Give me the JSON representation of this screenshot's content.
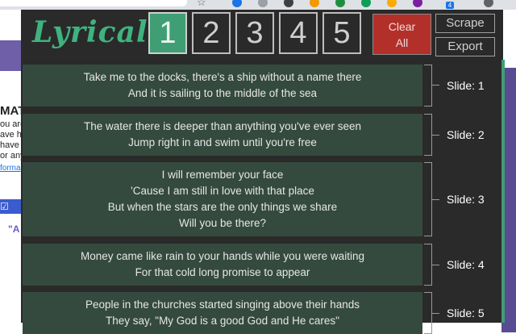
{
  "browser": {
    "star_icon": "star-icon",
    "extension_icons": [
      {
        "name": "blue-circle-extension-icon",
        "color": "#1a73e8"
      },
      {
        "name": "grey-circle-extension-icon",
        "color": "#9aa0a6"
      },
      {
        "name": "dark-extension-icon",
        "color": "#3c4043"
      },
      {
        "name": "orange-extension-icon",
        "color": "#f29900"
      },
      {
        "name": "green-extension-icon",
        "color": "#1e8e3e"
      },
      {
        "name": "teal-extension-icon",
        "color": "#0f9d58"
      },
      {
        "name": "yellow-extension-icon",
        "color": "#f9ab00"
      },
      {
        "name": "purple-extension-icon",
        "color": "#7b1fa2"
      },
      {
        "name": "profile-extension-icon",
        "color": "#5f6368"
      }
    ],
    "badge": "4"
  },
  "background_page": {
    "heading": "MAT",
    "lines": [
      "ou are",
      "ave ha",
      "have",
      "or any"
    ],
    "link": "forma",
    "email_button": "☑ Em",
    "quote": "\"A"
  },
  "extension": {
    "logo": "Lyrical",
    "number_buttons": [
      "1",
      "2",
      "3",
      "4",
      "5"
    ],
    "active_button": "1",
    "clear_button": {
      "line1": "Clear",
      "line2": "All"
    },
    "scrape_button": "Scrape",
    "export_button": "Export",
    "colors": {
      "accent": "#3f9e73",
      "clear": "#b3302a",
      "slide_bg": "#344a3f",
      "panel": "#2a2a2a"
    },
    "slides": [
      {
        "label": "Slide: 1",
        "lines": [
          "Take me to the docks, there's a ship without a name there",
          "And it is sailing to the middle of the sea"
        ]
      },
      {
        "label": "Slide: 2",
        "lines": [
          "The water there is deeper than anything you've ever seen",
          "Jump right in and swim until you're free"
        ]
      },
      {
        "label": "Slide: 3",
        "lines": [
          "I will remember your face",
          "'Cause I am still in love with that place",
          "But when the stars are the only things we share",
          "Will you be there?"
        ]
      },
      {
        "label": "Slide: 4",
        "lines": [
          "Money came like rain to your hands while you were waiting",
          "For that cold long promise to appear"
        ]
      },
      {
        "label": "Slide: 5",
        "lines": [
          "People in the churches started singing above their hands",
          "They say, \"My God is a good God and He cares\""
        ]
      }
    ]
  }
}
